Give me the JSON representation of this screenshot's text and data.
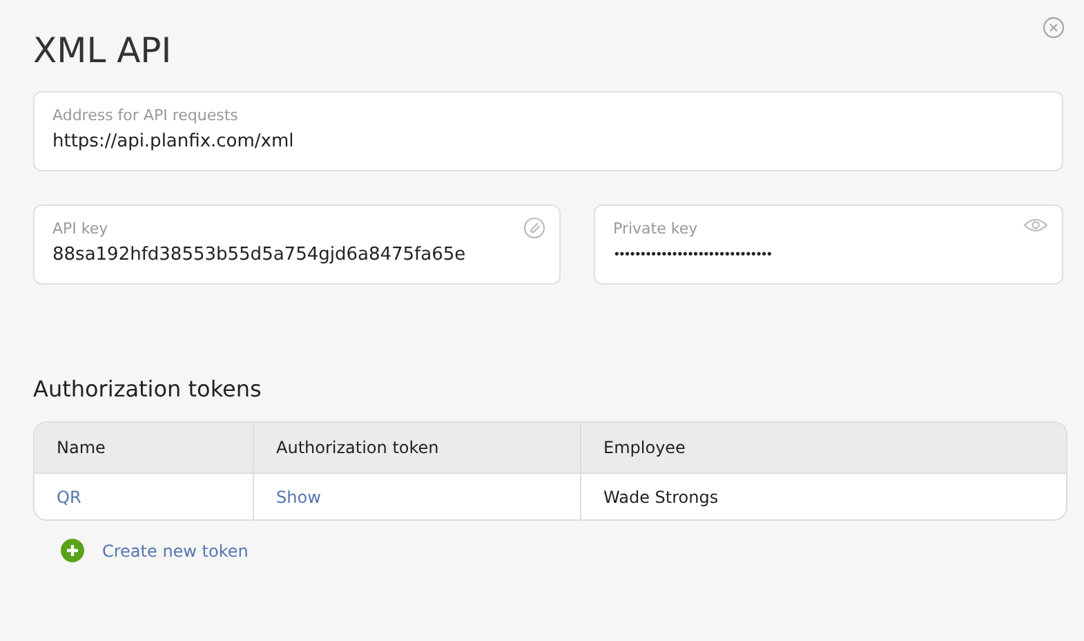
{
  "title": "XML API",
  "address": {
    "label": "Address for API requests",
    "value": "https://api.planfix.com/xml"
  },
  "api_key": {
    "label": "API key",
    "value": "88sa192hfd38553b55d5a754gjd6a8475fa65e"
  },
  "private_key": {
    "label": "Private key",
    "value": "••••••••••••••••••••••••••••••"
  },
  "tokens": {
    "heading": "Authorization tokens",
    "columns": [
      "Name",
      "Authorization token",
      "Employee"
    ],
    "rows": [
      {
        "name": "QR",
        "token": "Show",
        "employee": "Wade Strongs"
      }
    ],
    "create_label": "Create new token"
  }
}
